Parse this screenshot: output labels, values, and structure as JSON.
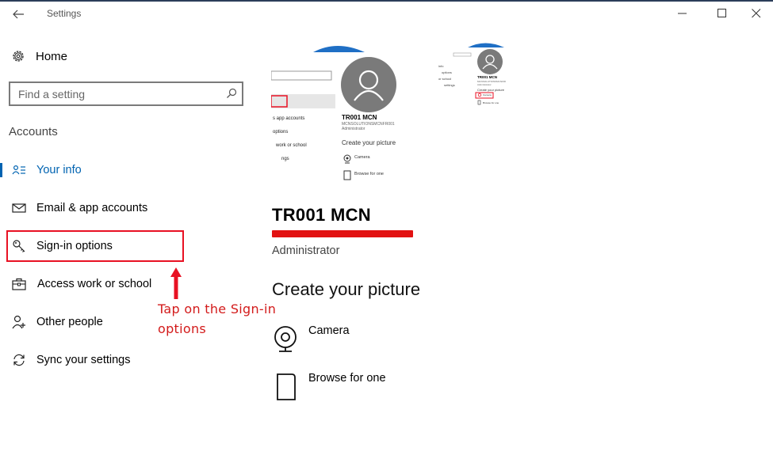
{
  "window": {
    "title": "Settings",
    "colors": {
      "accent": "#0063b1",
      "annotation": "#d31b1b",
      "highlight": "#e81123",
      "title_rule": "#2b3d59"
    }
  },
  "sidebar": {
    "home_label": "Home",
    "search": {
      "placeholder": "Find a setting"
    },
    "section_header": "Accounts",
    "items": [
      {
        "label": "Your info",
        "icon": "person-card-icon",
        "selected": true
      },
      {
        "label": "Email & app accounts",
        "icon": "mail-icon",
        "selected": false
      },
      {
        "label": "Sign-in options",
        "icon": "key-icon",
        "selected": false
      },
      {
        "label": "Access work or school",
        "icon": "briefcase-icon",
        "selected": false
      },
      {
        "label": "Other people",
        "icon": "person-add-icon",
        "selected": false
      },
      {
        "label": "Sync your settings",
        "icon": "sync-icon",
        "selected": false
      }
    ]
  },
  "annotation": {
    "text": "Tap on the Sign-in options",
    "target": "Sign-in options"
  },
  "main": {
    "account_name": "TR001 MCN",
    "account_role": "Administrator",
    "create_picture_heading": "Create your picture",
    "options": [
      {
        "label": "Camera",
        "icon": "camera-icon"
      },
      {
        "label": "Browse for one",
        "icon": "browse-file-icon"
      }
    ],
    "preview": {
      "name": "TR001 MCN",
      "subtitle": "MCNSOLUTIONSMCNFR001",
      "role": "Administrator",
      "heading": "Create your picture",
      "options": [
        "Camera",
        "Browse for one"
      ],
      "menu_fragments": [
        "s app accounts",
        "options",
        "work or school",
        "ngs"
      ],
      "small_menu_fragments": [
        "info",
        "options",
        "or school",
        "settings"
      ]
    }
  }
}
